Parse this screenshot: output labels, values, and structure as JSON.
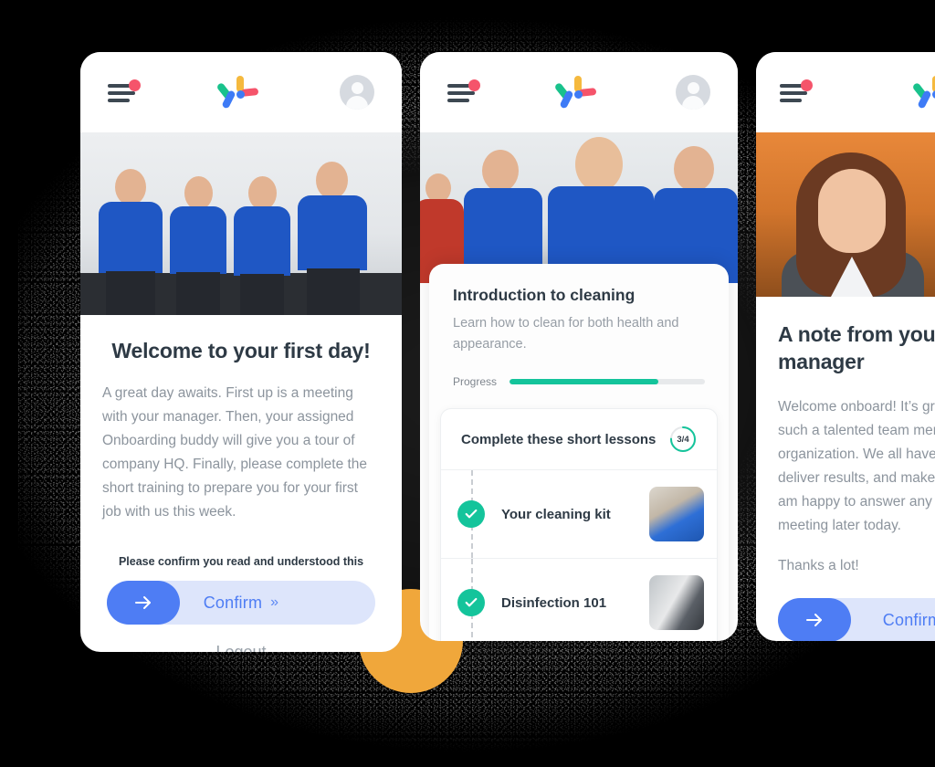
{
  "app": {
    "logo_name": "multicolor-leaf-logo",
    "logo_colors": {
      "green": "#19C28C",
      "yellow": "#F5B93E",
      "pink": "#F5546B",
      "blue": "#3E7BF6"
    },
    "menu_icon": "hamburger-menu-icon",
    "notification_dot_color": "#F5546B",
    "avatar_icon": "user-avatar-icon"
  },
  "theme": {
    "background": "#000000",
    "accent_circle": "#F0A73B",
    "primary_blue": "#4E7DF4",
    "slider_track": "#DDE5FB",
    "success_green": "#14C49B",
    "heading_color": "#2E3A45",
    "body_color": "#8C949D"
  },
  "screens": [
    {
      "id": "welcome",
      "photo_alt": "team-of-four-in-blue-polo-shirts",
      "title": "Welcome to your first day!",
      "body": "A great day awaits. First up is a meeting with your manager. Then, your assigned Onboarding buddy will give you a tour of company HQ. Finally, please complete the short training to prepare you for your first job with us this week.",
      "confirm_prompt": "Please confirm you read and understood this",
      "slider_label": "Confirm",
      "slider_chevrons": "»",
      "slider_arrow_icon": "arrow-right-icon",
      "logout_label": "Logout"
    },
    {
      "id": "course",
      "photo_alt": "trainees-seated-in-classroom",
      "title": "Introduction to cleaning",
      "subtitle": "Learn how to clean for both health and appearance.",
      "progress_label": "Progress",
      "progress_percent": 76,
      "lessons_heading": "Complete these short lessons",
      "lessons_badge": "3/4",
      "lessons_completed": 3,
      "lessons_total": 4,
      "lessons": [
        {
          "name": "Your cleaning kit",
          "status": "complete",
          "thumb_alt": "blue-gloved-hands-thumbnail"
        },
        {
          "name": "Disinfection 101",
          "status": "complete",
          "thumb_alt": "person-wiping-door-thumbnail"
        }
      ]
    },
    {
      "id": "manager-note",
      "photo_alt": "smiling-woman-portrait",
      "title": "A note from your manager",
      "body_lines": [
        "Welcome onboard! It’s great",
        "such a talented team memb",
        "organization. We all have fai",
        "deliver results, and make us",
        "am happy to answer any que",
        "meeting later today."
      ],
      "signoff": "Thanks a lot!",
      "slider_label": "Confirm",
      "slider_arrow_icon": "arrow-right-icon"
    }
  ]
}
